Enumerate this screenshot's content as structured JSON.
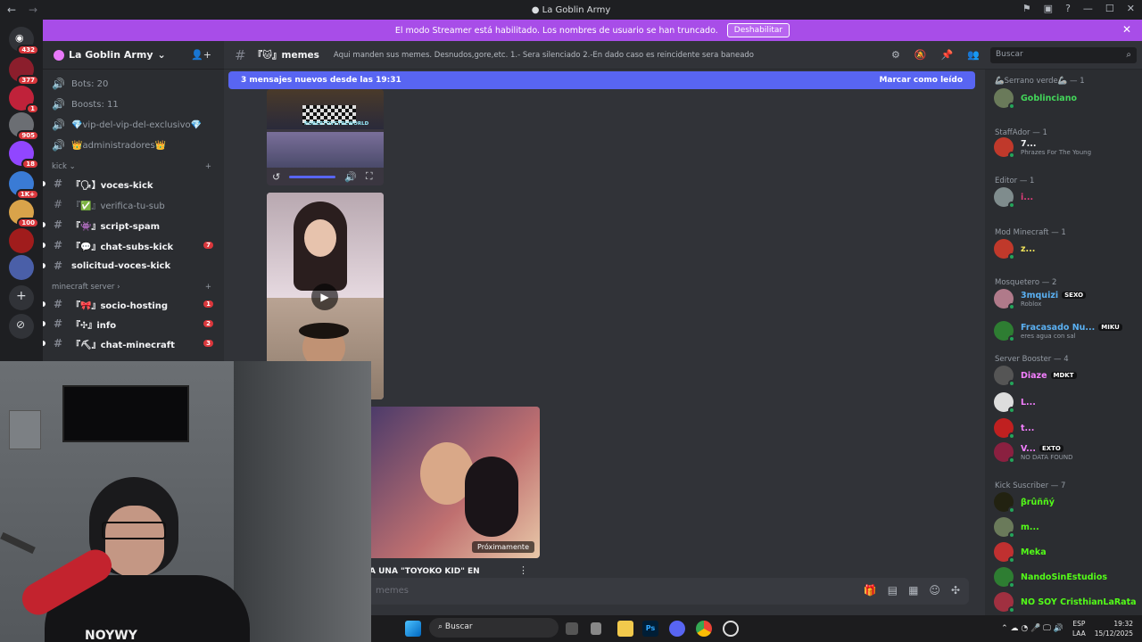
{
  "window": {
    "title": "La Goblin Army",
    "back": "←",
    "forward": "→"
  },
  "banner": {
    "text": "El modo Streamer está habilitado. Los nombres de usuario se han truncado.",
    "button": "Deshabilitar"
  },
  "servers": [
    {
      "badge": "432",
      "color": "#313338"
    },
    {
      "badge": "377",
      "color": "#8b1e2c"
    },
    {
      "badge": "1",
      "color": "#c0223a"
    },
    {
      "badge": "905",
      "color": "#6b6e73"
    },
    {
      "badge": "18",
      "color": "#9146ff"
    },
    {
      "badge": "1K+",
      "color": "#3a7bd5"
    },
    {
      "badge": "100",
      "color": "#d9a34a"
    },
    {
      "badge": "",
      "color": "#a01c1c"
    },
    {
      "badge": "",
      "color": "#4a5fa8"
    }
  ],
  "sidebar": {
    "server_name": "La Goblin Army",
    "top_items": [
      {
        "label": "Bots: 20"
      },
      {
        "label": "Boosts: 11"
      },
      {
        "label": "💎vip-del-vip-del-exclusivo💎"
      },
      {
        "label": "👑administradores👑"
      }
    ],
    "kick_category": "kick",
    "kick_channels": [
      {
        "label": "『🗣】voces-kick",
        "active": true,
        "badge": ""
      },
      {
        "label": "『✅』verifica-tu-sub",
        "active": false,
        "badge": ""
      },
      {
        "label": "『👾』script-spam",
        "active": true,
        "badge": ""
      },
      {
        "label": "『💬』chat-subs-kick",
        "active": true,
        "badge": "7"
      },
      {
        "label": "solicitud-voces-kick",
        "active": true,
        "badge": ""
      }
    ],
    "mc_category": "minecraft server",
    "mc_channels": [
      {
        "label": "『🎀』socio-hosting",
        "badge": "1"
      },
      {
        "label": "『✣』info",
        "badge": "2"
      },
      {
        "label": "『⛏』chat-minecraft",
        "badge": "3"
      }
    ]
  },
  "channel": {
    "name": "『🐱』memes",
    "topic": "Aqui manden sus memes. Desnudos,gore,etc. 1.- Sera silenciado 2.-En dado caso es reincidente sera baneado"
  },
  "search": {
    "placeholder": "Buscar"
  },
  "new_messages": {
    "text": "3 mensajes nuevos desde las 19:31",
    "mark": "Marcar como leído"
  },
  "media": {
    "video1_watermark": "ROBERTOVSTREWORLD",
    "video3_caption": "Próximamente",
    "video3_title": "A UNA \"TOYOKO KID\" EN"
  },
  "composer": {
    "placeholder": "memes"
  },
  "members": {
    "groups": [
      {
        "title": "🦾Serrano verde🦾 — 1",
        "members": [
          {
            "name": "Goblinciano",
            "sub": "",
            "color": "#43d65a",
            "tag": ""
          }
        ]
      },
      {
        "title": "StaffAdor — 1",
        "members": [
          {
            "name": "7...",
            "sub": "Phrazes For The Young",
            "color": "#f2f3f5",
            "tag": ""
          }
        ]
      },
      {
        "title": "Editor — 1",
        "members": [
          {
            "name": "i...",
            "sub": "",
            "color": "#e03d7a",
            "tag": ""
          }
        ]
      },
      {
        "title": "Mod Minecraft — 1",
        "members": [
          {
            "name": "z...",
            "sub": "",
            "color": "#f0e35a",
            "tag": ""
          }
        ]
      },
      {
        "title": "Mosquetero — 2",
        "members": [
          {
            "name": "3mquizi",
            "sub": "Roblox",
            "color": "#5ab0f2",
            "tag": "SEXO"
          },
          {
            "name": "Fracasado Nu...",
            "sub": "eres agua con sal",
            "color": "#5ab0f2",
            "tag": "MIKU"
          }
        ]
      },
      {
        "title": "Server Booster — 4",
        "members": [
          {
            "name": "Diaze",
            "sub": "",
            "color": "#f47fff",
            "tag": "MDKT"
          },
          {
            "name": "L...",
            "sub": "",
            "color": "#f47fff",
            "tag": ""
          },
          {
            "name": "t...",
            "sub": "",
            "color": "#f47fff",
            "tag": ""
          },
          {
            "name": "V...",
            "sub": "NO DATA FOUND",
            "color": "#f47fff",
            "tag": "EXTO"
          }
        ]
      },
      {
        "title": "Kick Suscriber — 7",
        "members": [
          {
            "name": "βrûññý",
            "sub": "",
            "color": "#53fc18",
            "tag": ""
          },
          {
            "name": "m...",
            "sub": "",
            "color": "#53fc18",
            "tag": ""
          },
          {
            "name": "Meka",
            "sub": "",
            "color": "#53fc18",
            "tag": ""
          },
          {
            "name": "NandoSinEstudios",
            "sub": "",
            "color": "#53fc18",
            "tag": ""
          },
          {
            "name": "NO SOY CristhianLaRata",
            "sub": "",
            "color": "#53fc18",
            "tag": ""
          }
        ]
      }
    ]
  },
  "webcam": {
    "shirt_text": "NOYWY"
  },
  "taskbar": {
    "search": "Buscar",
    "lang1": "ESP",
    "lang2": "LAA",
    "time": "19:32",
    "date": "15/12/2025"
  }
}
